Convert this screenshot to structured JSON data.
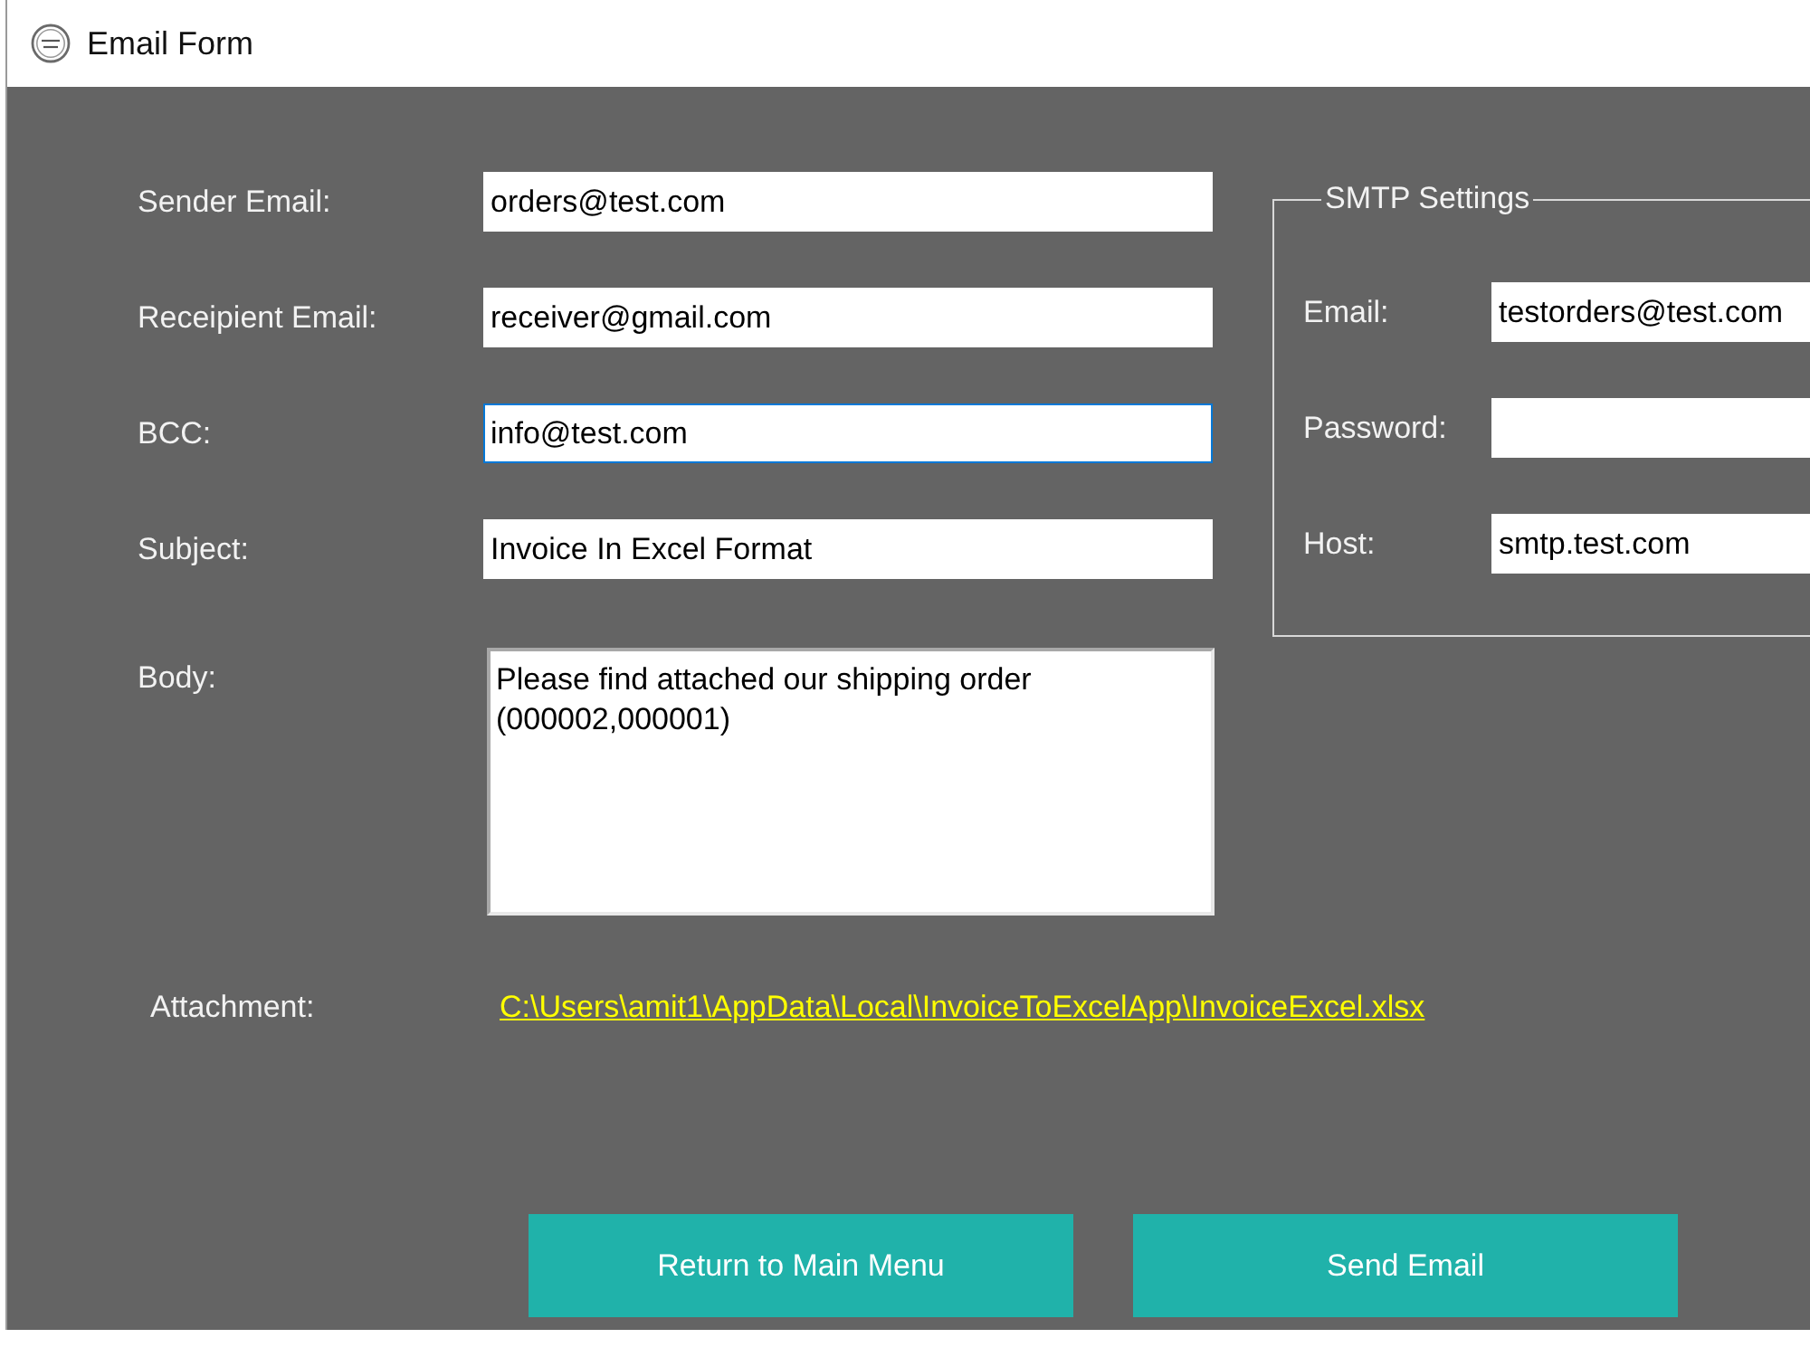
{
  "window": {
    "title": "Email Form"
  },
  "form": {
    "fields": [
      {
        "label": "Sender Email:",
        "value": "orders@test.com",
        "focused": false
      },
      {
        "label": "Receipient Email:",
        "value": "receiver@gmail.com",
        "focused": false
      },
      {
        "label": "BCC:",
        "value": "info@test.com",
        "focused": true
      },
      {
        "label": "Subject:",
        "value": "Invoice In Excel Format",
        "focused": false
      }
    ],
    "body": {
      "label": "Body:",
      "value": "Please find attached our shipping order (000002,000001)"
    },
    "attachment": {
      "label": "Attachment:",
      "link": "C:\\Users\\amit1\\AppData\\Local\\InvoiceToExcelApp\\InvoiceExcel.xlsx"
    }
  },
  "smtp_settings": {
    "title": "SMTP Settings",
    "fields": [
      {
        "label": "Email:",
        "value": "testorders@test.com"
      },
      {
        "label": "Password:"
      },
      {
        "label": "Host:",
        "value": "smtp.test.com"
      }
    ]
  },
  "buttons": [
    "Return to Main Menu",
    "Send Email"
  ]
}
